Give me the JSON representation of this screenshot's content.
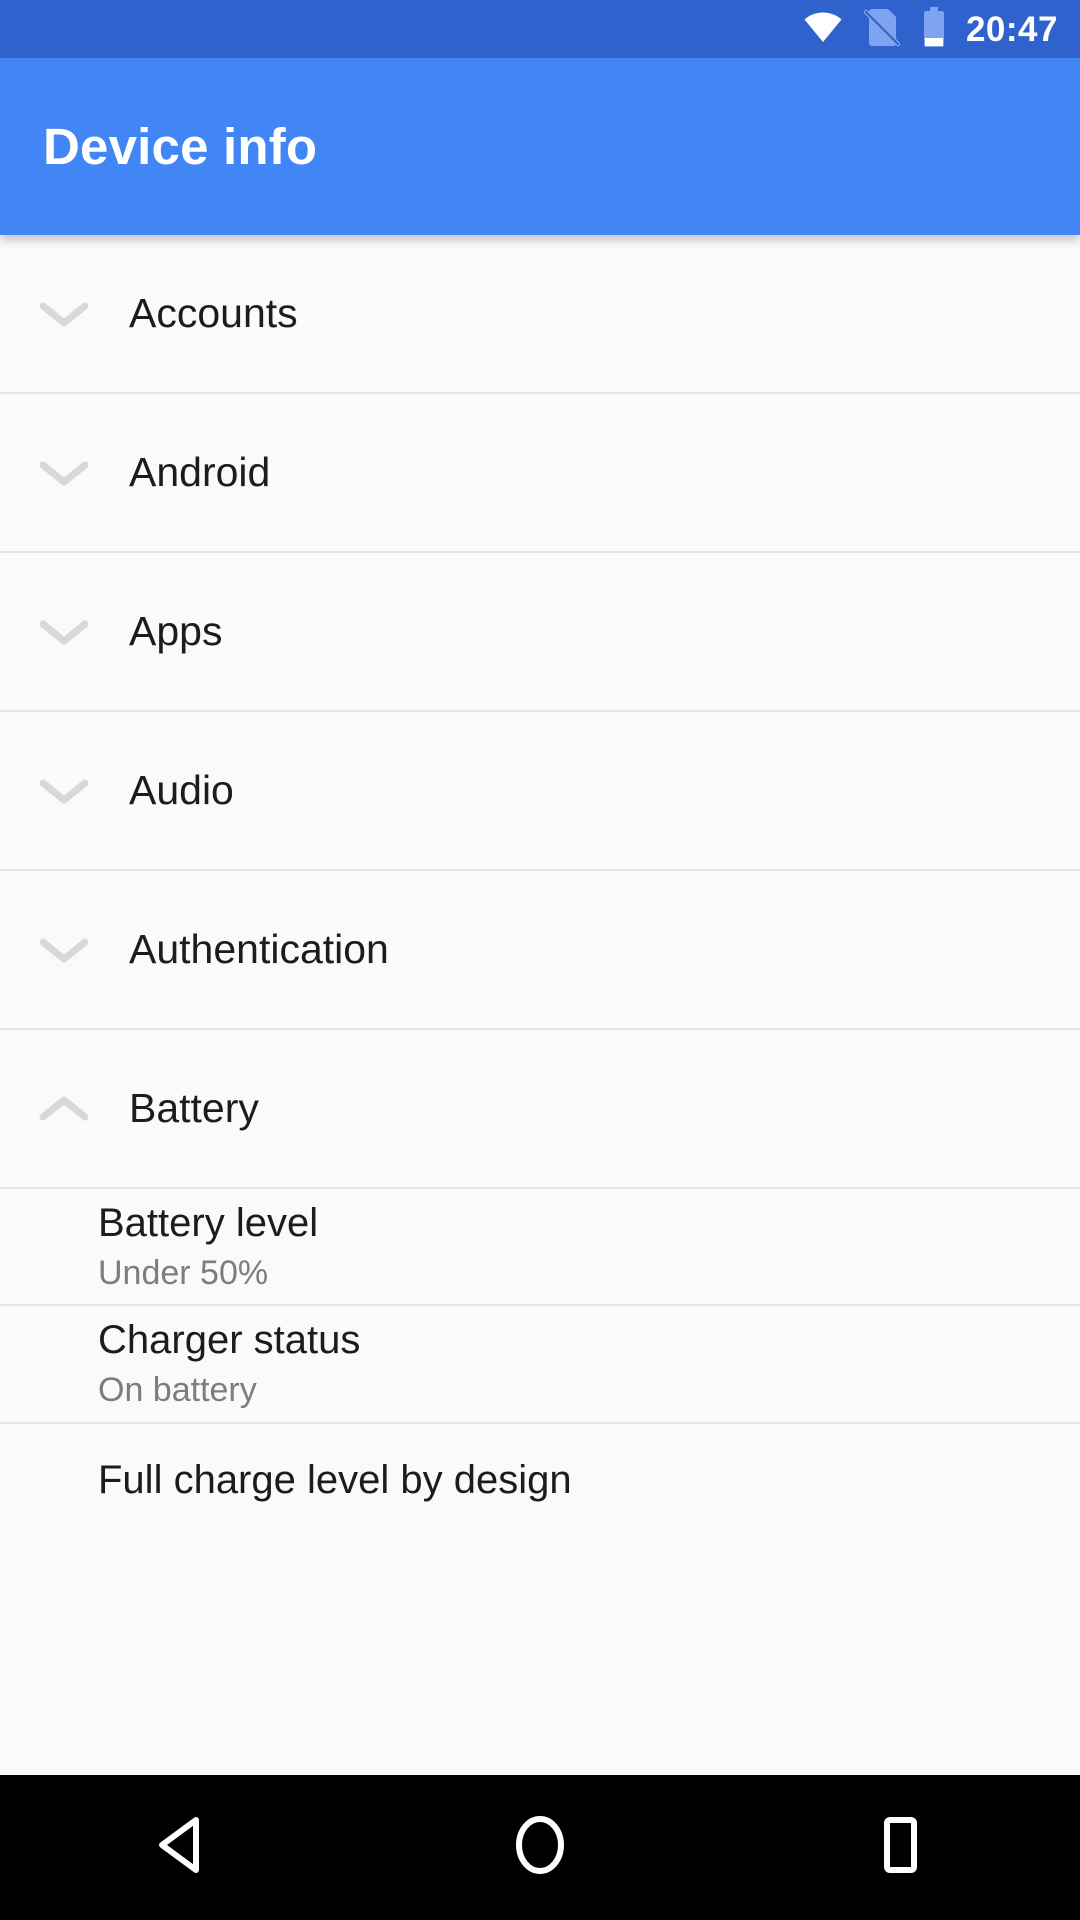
{
  "status_bar": {
    "time": "20:47",
    "icons": [
      {
        "name": "wifi-icon",
        "label": "Wi-Fi connected",
        "state": "active"
      },
      {
        "name": "no-sim-icon",
        "label": "No SIM card",
        "state": "dimmed"
      },
      {
        "name": "battery-icon",
        "label": "Battery low",
        "state": "dimmed"
      }
    ],
    "colors": {
      "background": "#3062ce",
      "foreground": "#ffffff",
      "dimmed": "#7fa3ee"
    }
  },
  "app_bar": {
    "title": "Device info",
    "colors": {
      "background": "#4285f4",
      "title": "#ffffff"
    }
  },
  "colors": {
    "page_background": "#fafafa",
    "divider": "#e4e4e4",
    "primary_text": "#1c1c1c",
    "secondary_text": "#7d7d7d",
    "chevron": "#d8d8d8",
    "nav_background": "#000000",
    "nav_icon": "#ffffff"
  },
  "list": {
    "groups": [
      {
        "label": "Accounts",
        "expanded": false,
        "chevron": "chevron-down-icon"
      },
      {
        "label": "Android",
        "expanded": false,
        "chevron": "chevron-down-icon"
      },
      {
        "label": "Apps",
        "expanded": false,
        "chevron": "chevron-down-icon"
      },
      {
        "label": "Audio",
        "expanded": false,
        "chevron": "chevron-down-icon"
      },
      {
        "label": "Authentication",
        "expanded": false,
        "chevron": "chevron-down-icon"
      },
      {
        "label": "Battery",
        "expanded": true,
        "chevron": "chevron-up-icon"
      }
    ],
    "battery_details": [
      {
        "title": "Battery level",
        "value": "Under 50%"
      },
      {
        "title": "Charger status",
        "value": "On battery"
      },
      {
        "title": "Full charge level by design",
        "value": ""
      }
    ]
  },
  "nav_bar": {
    "buttons": [
      {
        "name": "back-button",
        "label": "Back",
        "icon": "triangle-left-icon"
      },
      {
        "name": "home-button",
        "label": "Home",
        "icon": "circle-icon"
      },
      {
        "name": "recents-button",
        "label": "Recents",
        "icon": "square-icon"
      }
    ]
  }
}
